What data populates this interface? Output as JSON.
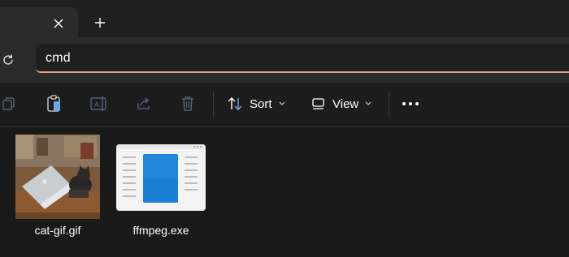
{
  "tabs": {
    "close_icon": "close-icon",
    "new_tab_icon": "plus-icon"
  },
  "address_bar": {
    "value": "cmd",
    "accent_color": "#e8a089"
  },
  "command_bar": {
    "icons": [
      "copy-icon",
      "paste-icon",
      "rename-icon",
      "share-icon",
      "delete-icon",
      "more-icon"
    ],
    "sort_label": "Sort",
    "view_label": "View"
  },
  "files": [
    {
      "name": "cat-gif.gif",
      "icon": "gif-thumbnail"
    },
    {
      "name": "ffmpeg.exe",
      "icon": "application-icon",
      "accent": "#1a7ed6"
    }
  ]
}
